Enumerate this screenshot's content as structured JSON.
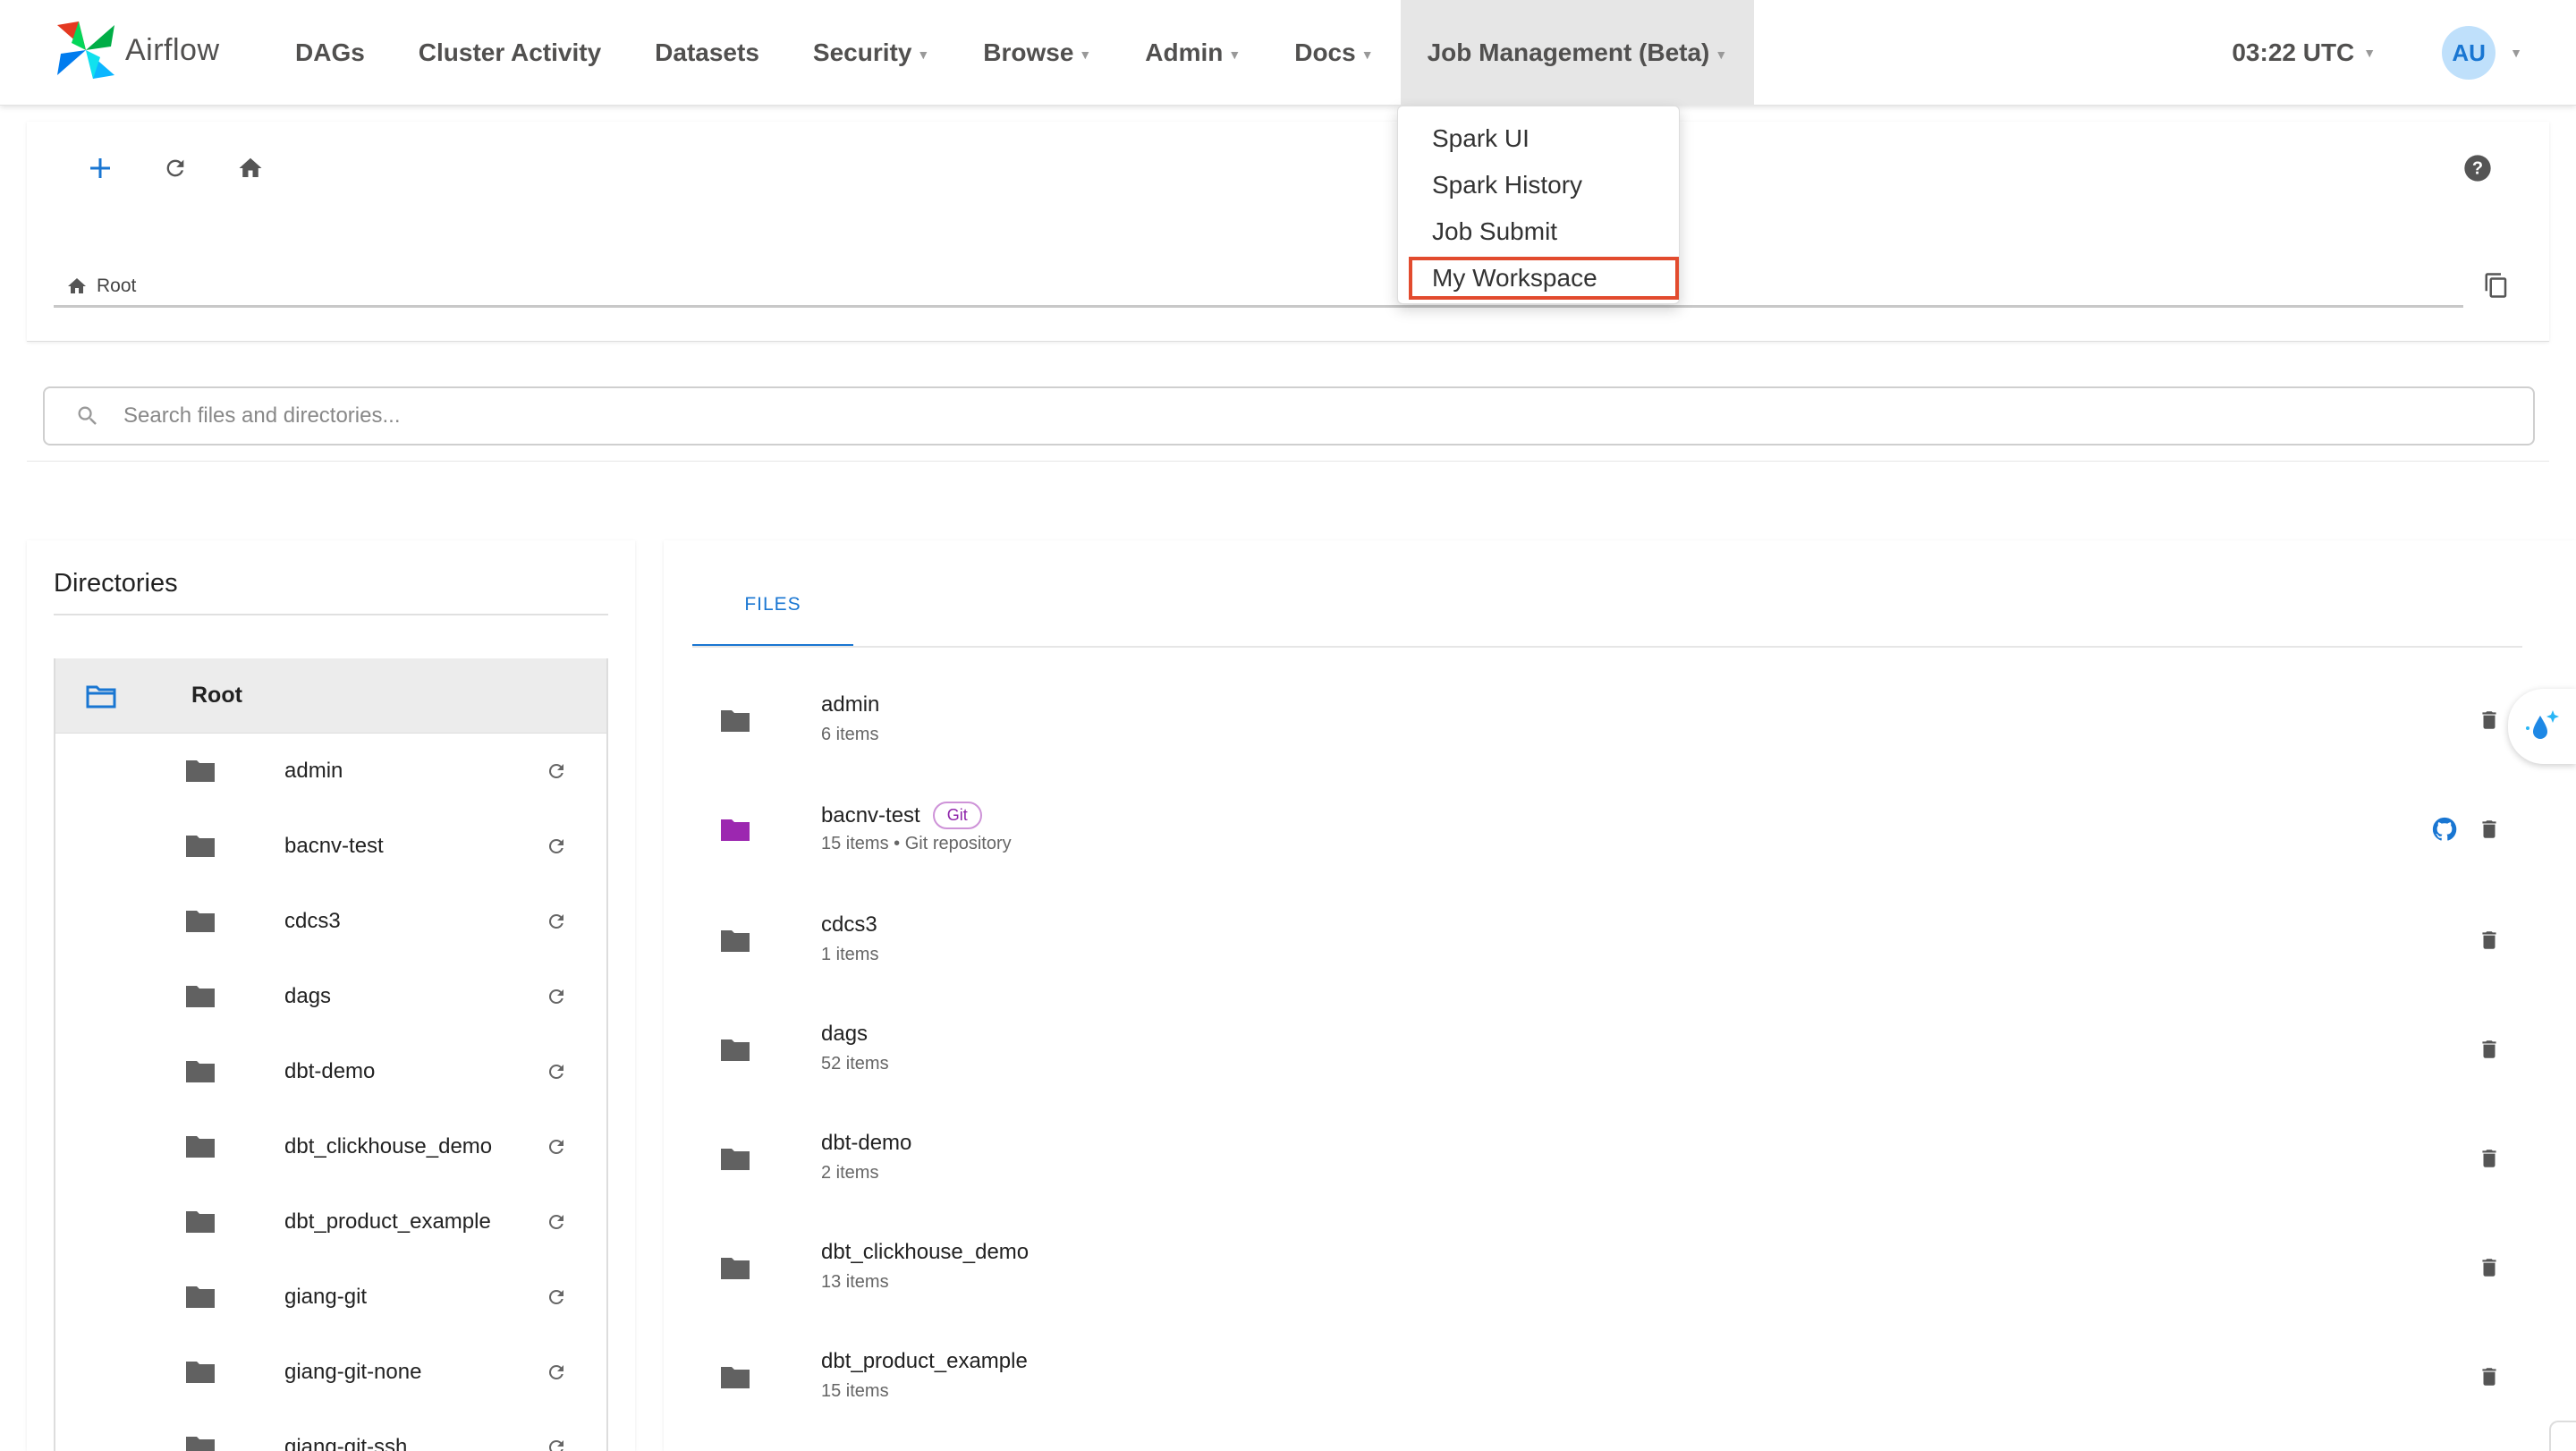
{
  "navbar": {
    "brand": "Airflow",
    "items": [
      {
        "label": "DAGs",
        "caret": false
      },
      {
        "label": "Cluster Activity",
        "caret": false
      },
      {
        "label": "Datasets",
        "caret": false
      },
      {
        "label": "Security",
        "caret": true
      },
      {
        "label": "Browse",
        "caret": true
      },
      {
        "label": "Admin",
        "caret": true
      },
      {
        "label": "Docs",
        "caret": true
      },
      {
        "label": "Job Management (Beta)",
        "caret": true
      }
    ],
    "time": "03:22 UTC",
    "avatar": "AU"
  },
  "dropdown": {
    "items": [
      "Spark UI",
      "Spark History",
      "Job Submit",
      "My Workspace"
    ],
    "highlighted": "My Workspace",
    "highlight_color": "#e24b2e"
  },
  "toolbar": {
    "icons": [
      "plus-icon",
      "refresh-icon",
      "home-icon",
      "help-icon"
    ],
    "breadcrumb": "Root"
  },
  "search": {
    "placeholder": "Search files and directories..."
  },
  "directories": {
    "title": "Directories",
    "root_label": "Root",
    "items": [
      "admin",
      "bacnv-test",
      "cdcs3",
      "dags",
      "dbt-demo",
      "dbt_clickhouse_demo",
      "dbt_product_example",
      "giang-git",
      "giang-git-none",
      "giang-git-ssh"
    ]
  },
  "files": {
    "tab": "FILES",
    "rows": [
      {
        "name": "admin",
        "meta": "6 items",
        "git": false
      },
      {
        "name": "bacnv-test",
        "meta": "15 items • Git repository",
        "git": true,
        "badge": "Git"
      },
      {
        "name": "cdcs3",
        "meta": "1 items",
        "git": false
      },
      {
        "name": "dags",
        "meta": "52 items",
        "git": false
      },
      {
        "name": "dbt-demo",
        "meta": "2 items",
        "git": false
      },
      {
        "name": "dbt_clickhouse_demo",
        "meta": "13 items",
        "git": false
      },
      {
        "name": "dbt_product_example",
        "meta": "15 items",
        "git": false
      }
    ]
  },
  "colors": {
    "accent": "#1976d2",
    "folder": "#616161",
    "git_folder": "#9c27b0",
    "highlight": "#e24b2e"
  }
}
